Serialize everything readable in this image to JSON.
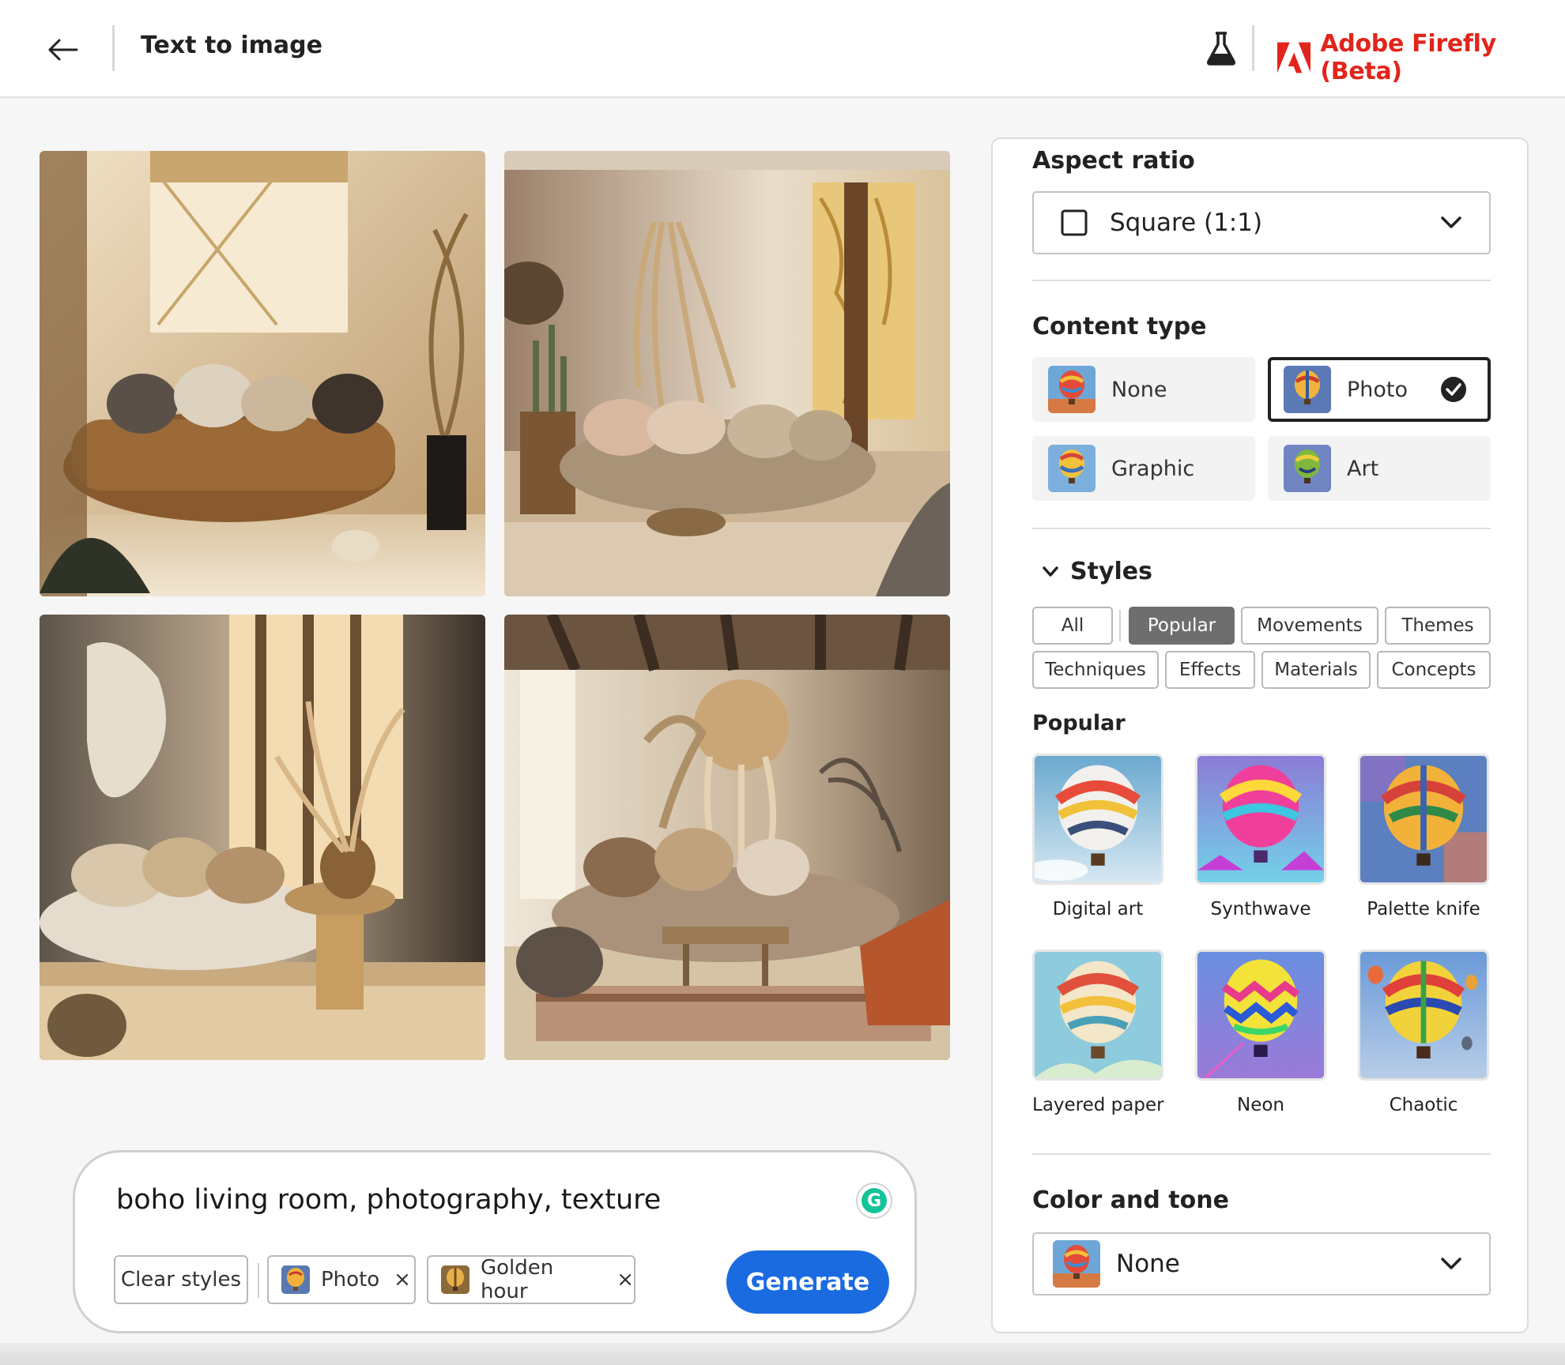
{
  "header": {
    "title": "Text to image",
    "brand": "Adobe Firefly (Beta)",
    "colors": {
      "brand": "#e1251b",
      "accent": "#1a6be0"
    }
  },
  "images": [
    {
      "name": "generated-image-1"
    },
    {
      "name": "generated-image-2"
    },
    {
      "name": "generated-image-3"
    },
    {
      "name": "generated-image-4"
    }
  ],
  "prompt": {
    "text": "boho living room, photography, texture",
    "clear_label": "Clear styles",
    "chips": [
      {
        "label": "Photo",
        "remove": "×"
      },
      {
        "label": "Golden hour",
        "remove": "×"
      }
    ],
    "generate_label": "Generate"
  },
  "panel": {
    "aspect_ratio": {
      "title": "Aspect ratio",
      "value": "Square (1:1)"
    },
    "content_type": {
      "title": "Content type",
      "options": [
        {
          "label": "None",
          "selected": false
        },
        {
          "label": "Photo",
          "selected": true
        },
        {
          "label": "Graphic",
          "selected": false
        },
        {
          "label": "Art",
          "selected": false
        }
      ]
    },
    "styles": {
      "title": "Styles",
      "filters": [
        "All",
        "Popular",
        "Movements",
        "Themes",
        "Techniques",
        "Effects",
        "Materials",
        "Concepts"
      ],
      "active_filter": "Popular",
      "section_title": "Popular",
      "items": [
        {
          "label": "Digital art"
        },
        {
          "label": "Synthwave"
        },
        {
          "label": "Palette knife"
        },
        {
          "label": "Layered paper"
        },
        {
          "label": "Neon"
        },
        {
          "label": "Chaotic"
        }
      ]
    },
    "color_tone": {
      "title": "Color and tone",
      "value": "None"
    }
  }
}
